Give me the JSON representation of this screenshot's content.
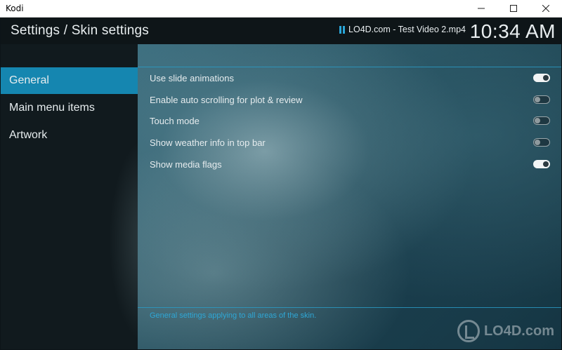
{
  "window": {
    "title": "Kodi",
    "controls": [
      "minimize-icon",
      "maximize-icon",
      "close-icon"
    ]
  },
  "header": {
    "title": "Settings / Skin settings",
    "now_playing": "LO4D.com - Test Video 2.mp4",
    "now_playing_icon": "pause-icon",
    "clock": "10:34 AM"
  },
  "sidebar": {
    "items": [
      {
        "label": "General",
        "active": true
      },
      {
        "label": "Main menu items",
        "active": false
      },
      {
        "label": "Artwork",
        "active": false
      }
    ]
  },
  "settings": [
    {
      "label": "Use slide animations",
      "enabled": true
    },
    {
      "label": "Enable auto scrolling for plot & review",
      "enabled": false
    },
    {
      "label": "Touch mode",
      "enabled": false
    },
    {
      "label": "Show weather info in top bar",
      "enabled": false
    },
    {
      "label": "Show media flags",
      "enabled": true
    }
  ],
  "footer": {
    "hint": "General settings applying to all areas of the skin."
  },
  "watermark": {
    "text": "LO4D.com"
  },
  "colors": {
    "accent": "#1586b0",
    "hint_text": "#2ea7d6"
  }
}
